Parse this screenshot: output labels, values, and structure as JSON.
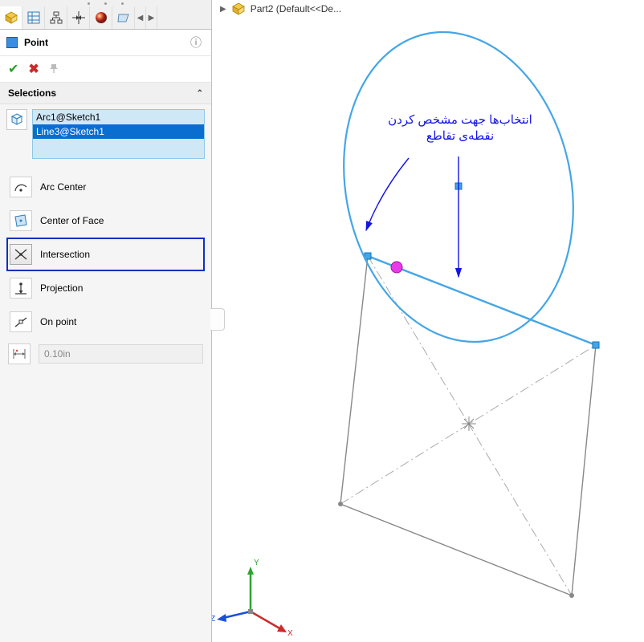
{
  "header": {
    "title": "Point"
  },
  "breadcrumb": {
    "part_label": "Part2 (Default<<De..."
  },
  "section": {
    "title": "Selections"
  },
  "selections": {
    "items": [
      "Arc1@Sketch1",
      "Line3@Sketch1"
    ]
  },
  "options": {
    "arc_center": "Arc Center",
    "center_face": "Center of Face",
    "intersection": "Intersection",
    "projection": "Projection",
    "on_point": "On point"
  },
  "dimension": {
    "value": "0.10in"
  },
  "annotation": {
    "line1": "انتخاب‌ها جهت مشخص کردن",
    "line2": "نقطه‌ی تقاطع"
  },
  "axes": {
    "x": "X",
    "y": "Y",
    "z": "Z"
  }
}
